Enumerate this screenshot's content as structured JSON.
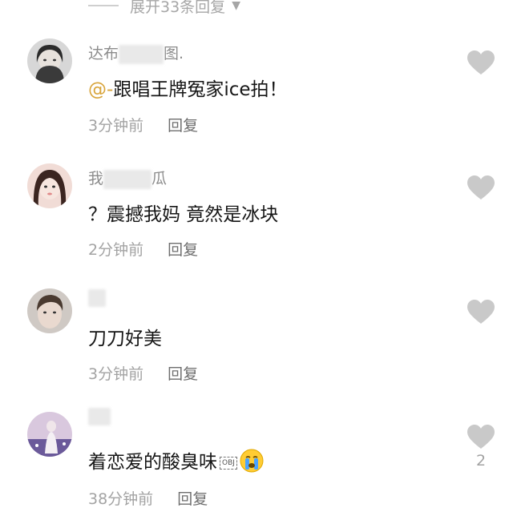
{
  "expand": {
    "label": "展开33条回复"
  },
  "comments": [
    {
      "name": "达布",
      "name_tail": "图.",
      "mention": "@-",
      "text": "跟唱王牌冤家ice拍！",
      "time": "3分钟前",
      "reply": "回复",
      "likes": ""
    },
    {
      "name": "我",
      "name_tail": "瓜",
      "text": "？震撼我妈 竟然是冰块",
      "time": "2分钟前",
      "reply": "回复",
      "likes": ""
    },
    {
      "name": "",
      "name_tail": "",
      "text": "刀刀好美",
      "time": "3分钟前",
      "reply": "回复",
      "likes": ""
    },
    {
      "name": "",
      "name_tail": "",
      "text": "着恋爱的酸臭味",
      "obj": "OBJ",
      "emoji": "crying-face-icon",
      "time": "38分钟前",
      "reply": "回复",
      "likes": "2"
    }
  ],
  "colors": {
    "mention": "#d8a43a",
    "heart": "#c9c9c9",
    "text": "#161616",
    "meta": "#a3a3a3"
  }
}
